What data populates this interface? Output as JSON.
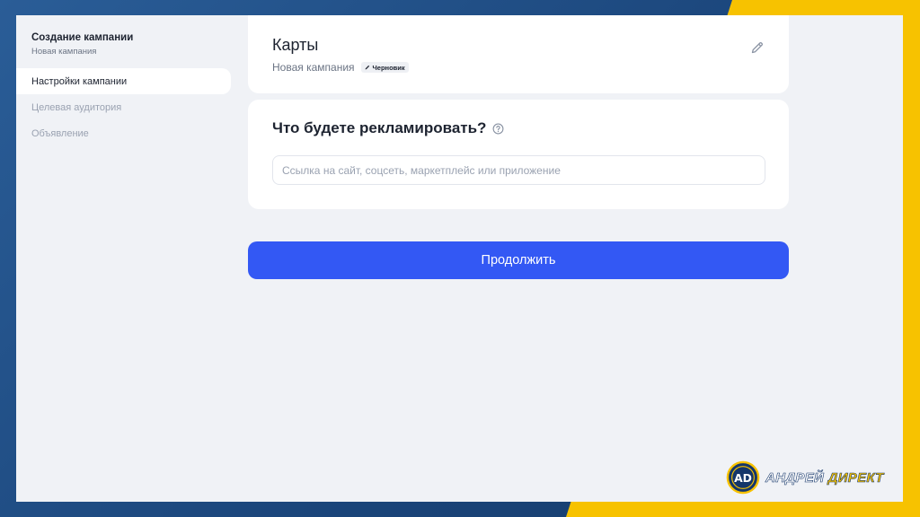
{
  "sidebar": {
    "title": "Создание кампании",
    "subtitle": "Новая кампания",
    "items": [
      {
        "label": "Настройки кампании",
        "active": true
      },
      {
        "label": "Целевая аудитория",
        "active": false
      },
      {
        "label": "Объявление",
        "active": false
      }
    ]
  },
  "campaign_card": {
    "title": "Карты",
    "subtitle": "Новая кампания",
    "badge": "Черновик",
    "edit_icon": "pencil-icon"
  },
  "ad_card": {
    "question": "Что будете рекламировать?",
    "help_icon": "question-circle-icon",
    "input_placeholder": "Ссылка на сайт, соцсеть, маркетплейс или приложение",
    "input_value": ""
  },
  "actions": {
    "continue_label": "Продолжить"
  },
  "watermark": {
    "text_part1": "АНДРЕЙ",
    "text_part2": "ДИРЕКТ",
    "monogram": "AD"
  },
  "colors": {
    "accent": "#3358f4",
    "frame_bg": "#f0f2f6",
    "outer_blue": "#1f4d86",
    "outer_yellow": "#f7c200"
  }
}
